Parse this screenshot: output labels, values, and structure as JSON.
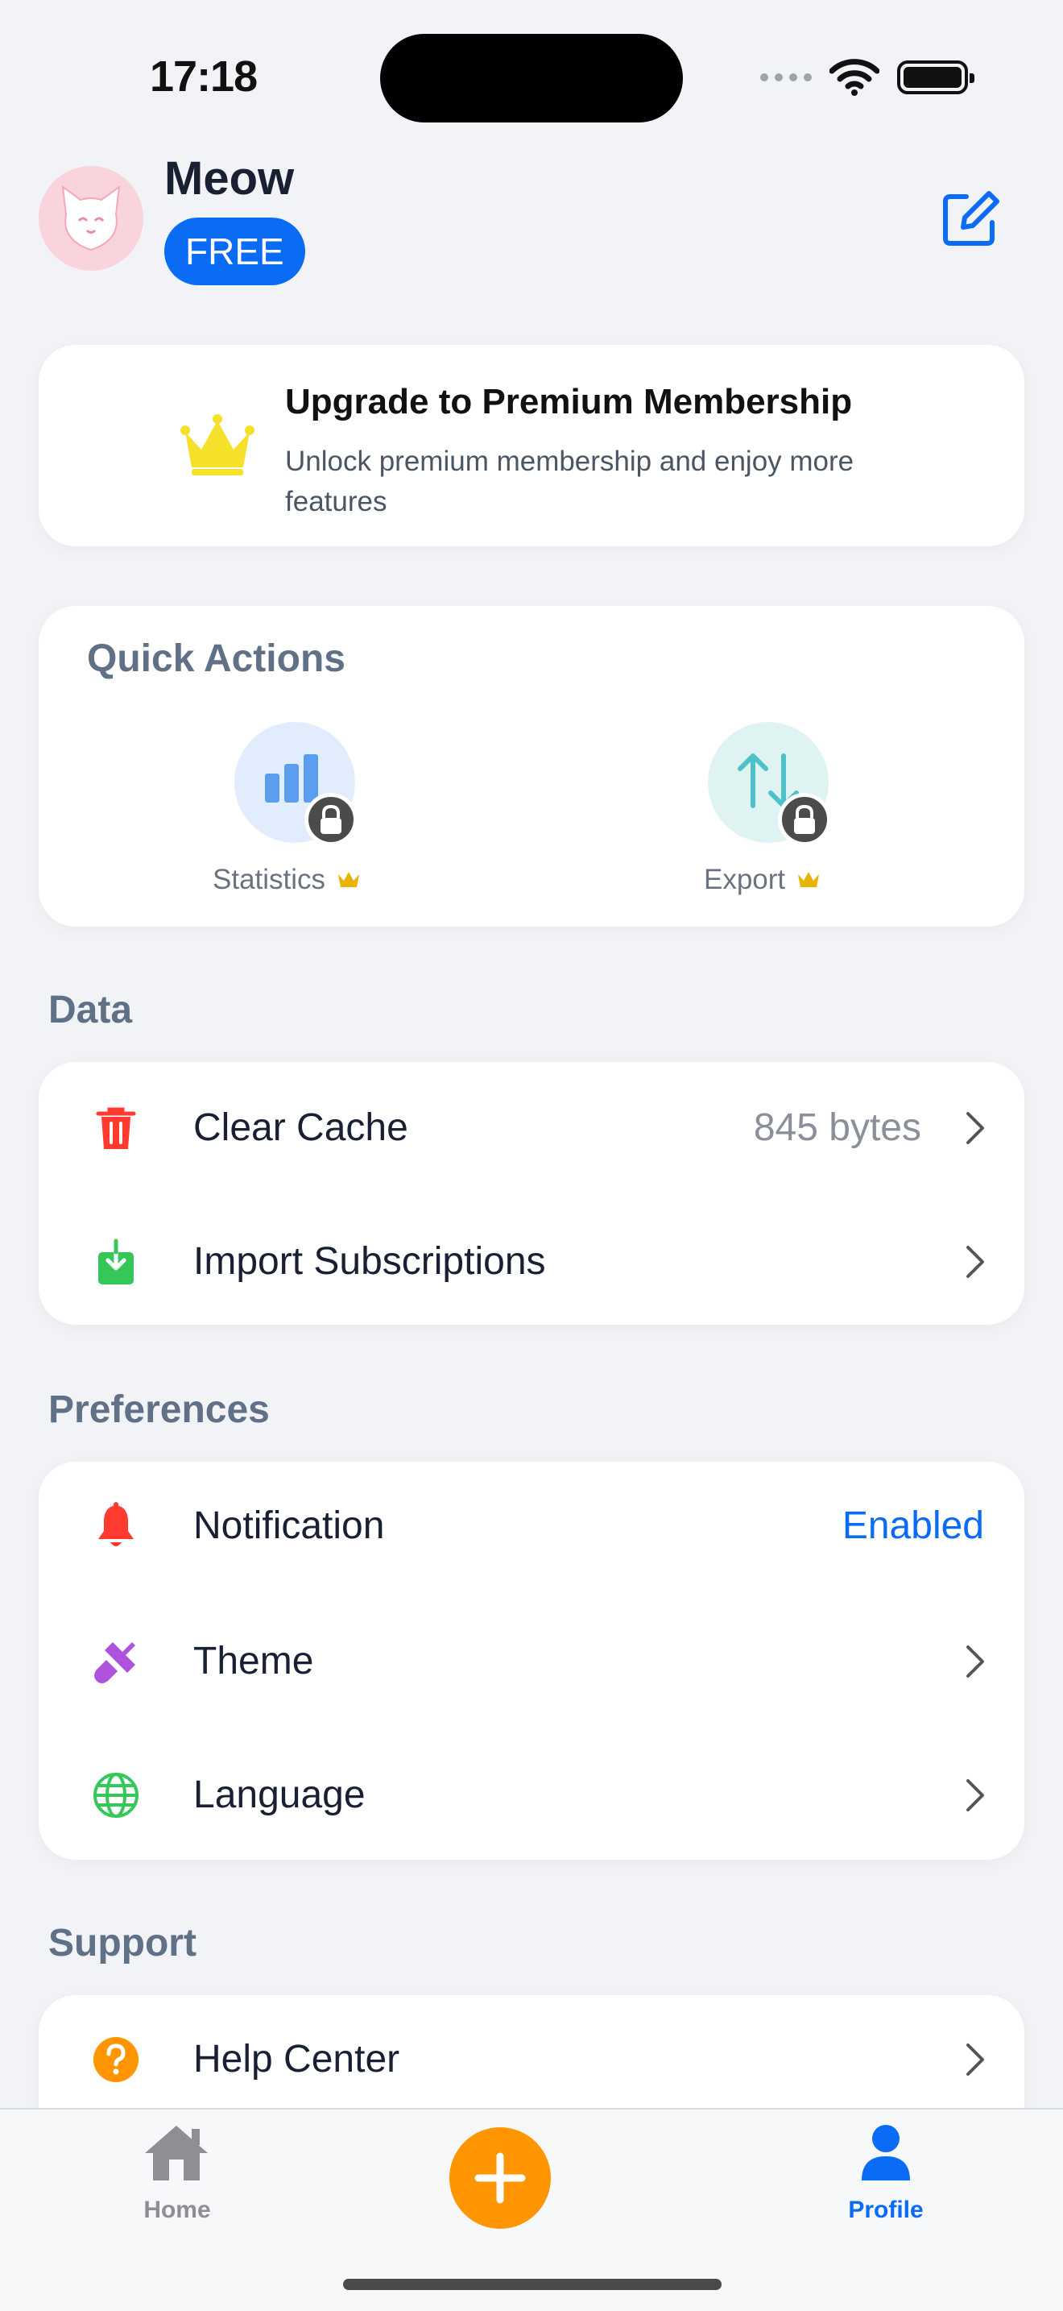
{
  "status_bar": {
    "time": "17:18"
  },
  "profile": {
    "name": "Meow",
    "plan": "FREE"
  },
  "premium": {
    "title": "Upgrade to Premium Membership",
    "description": "Unlock premium membership and enjoy more features"
  },
  "quick_actions": {
    "title": "Quick Actions",
    "items": [
      {
        "label": "Statistics",
        "icon": "bar-chart-icon",
        "locked": true
      },
      {
        "label": "Export",
        "icon": "arrows-up-down-icon",
        "locked": true
      }
    ]
  },
  "data_section": {
    "title": "Data",
    "items": [
      {
        "label": "Clear Cache",
        "value": "845 bytes",
        "icon": "trash-icon"
      },
      {
        "label": "Import Subscriptions",
        "value": "",
        "icon": "import-icon"
      }
    ]
  },
  "preferences": {
    "title": "Preferences",
    "items": [
      {
        "label": "Notification",
        "value": "Enabled",
        "icon": "bell-icon"
      },
      {
        "label": "Theme",
        "value": "",
        "icon": "paintbrush-icon"
      },
      {
        "label": "Language",
        "value": "",
        "icon": "globe-icon"
      }
    ]
  },
  "support": {
    "title": "Support",
    "items": [
      {
        "label": "Help Center",
        "value": "",
        "icon": "question-icon"
      }
    ]
  },
  "tabbar": {
    "home_label": "Home",
    "profile_label": "Profile",
    "active": "Profile"
  },
  "colors": {
    "accent": "#0a6cf5",
    "fab": "#ff9500",
    "section_title": "#5f7087",
    "danger": "#ff3b30",
    "success": "#34c759",
    "theme": "#af52de",
    "crown": "#f5e12a"
  }
}
